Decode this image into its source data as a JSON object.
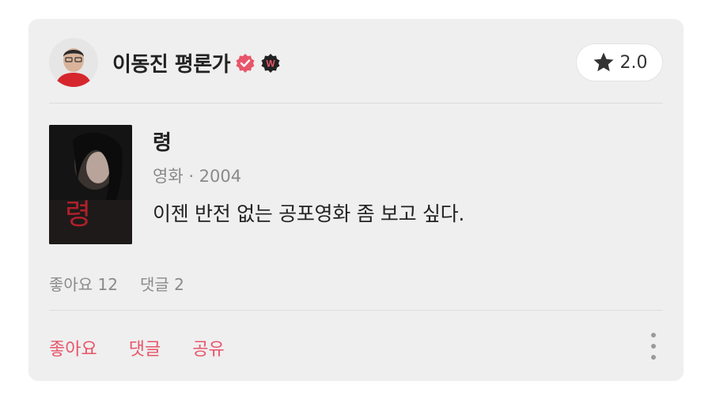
{
  "author": {
    "name": "이동진 평론가",
    "avatar_icon": "avatar-photo",
    "verified_icon": "verified-check-icon",
    "brand_icon": "watcha-w-icon",
    "brand_letter": "W"
  },
  "rating": {
    "icon": "star-icon",
    "value": "2.0"
  },
  "movie": {
    "title": "령",
    "meta": "영화 · 2004",
    "poster_title": "령"
  },
  "review": {
    "text": "이젠 반전 없는 공포영화 좀 보고 싶다."
  },
  "stats": {
    "likes": "좋아요 12",
    "comments": "댓글 2"
  },
  "actions": {
    "like": "좋아요",
    "comment": "댓글",
    "share": "공유",
    "more_icon": "more-vertical-icon"
  },
  "colors": {
    "accent": "#e8556a",
    "card_bg": "#efefef",
    "muted": "#8a8a8a"
  }
}
